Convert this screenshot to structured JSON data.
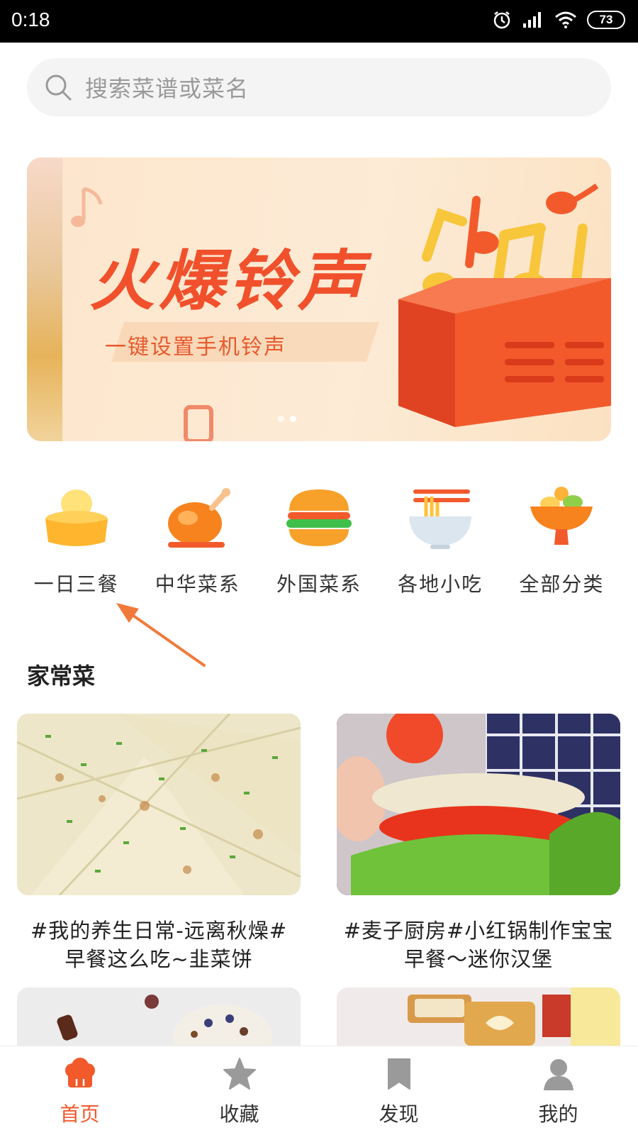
{
  "status_bar": {
    "time": "0:18",
    "battery": "73",
    "icons": [
      "alarm-icon",
      "signal-icon",
      "wifi-icon",
      "battery-icon"
    ]
  },
  "search": {
    "placeholder": "搜索菜谱或菜名",
    "icon": "search-icon"
  },
  "banner": {
    "title": "火爆铃声",
    "subtitle": "一键设置手机铃声",
    "page_count": 2,
    "active_page": 2
  },
  "categories": [
    {
      "label": "一日三餐",
      "icon": "meal-bowl-icon"
    },
    {
      "label": "中华菜系",
      "icon": "roast-chicken-icon"
    },
    {
      "label": "外国菜系",
      "icon": "burger-icon"
    },
    {
      "label": "各地小吃",
      "icon": "noodle-bowl-icon"
    },
    {
      "label": "全部分类",
      "icon": "dish-stand-icon"
    }
  ],
  "section": {
    "title": "家常菜"
  },
  "recipes": [
    {
      "title_line1": "#我的养生日常-远离秋燥#",
      "title_line2": "早餐这么吃~韭菜饼"
    },
    {
      "title_line1": "#麦子厨房#小红锅制作宝宝",
      "title_line2": "早餐～迷你汉堡"
    }
  ],
  "tab_bar": {
    "tabs": [
      {
        "label": "首页",
        "icon": "chef-hat-icon",
        "active": true
      },
      {
        "label": "收藏",
        "icon": "star-icon",
        "active": false
      },
      {
        "label": "发现",
        "icon": "bookmark-icon",
        "active": false
      },
      {
        "label": "我的",
        "icon": "user-icon",
        "active": false
      }
    ]
  },
  "colors": {
    "accent": "#f25a2c",
    "banner_bg": "#fde6cd",
    "search_bg": "#f4f4f4"
  }
}
